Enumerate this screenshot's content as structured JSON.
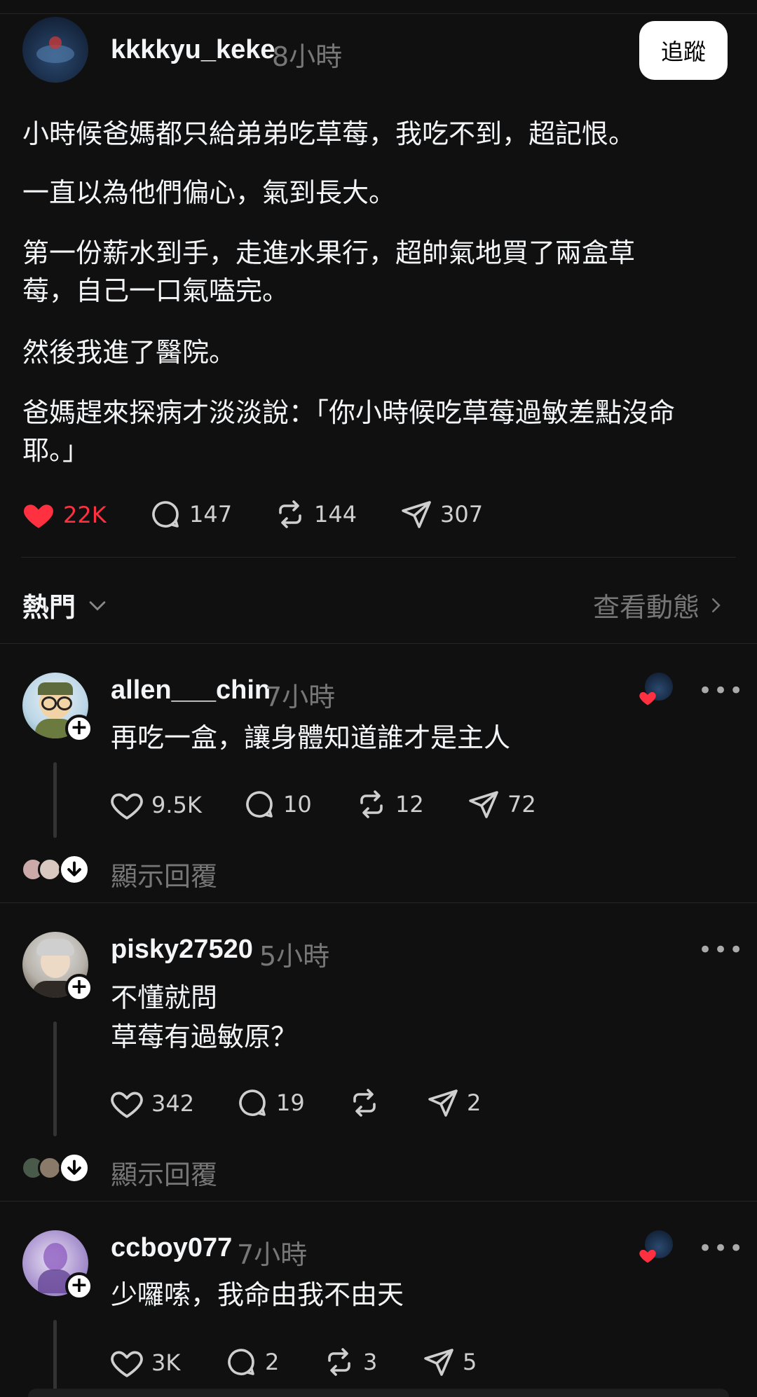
{
  "post": {
    "username": "kkkkyu_keke",
    "time": "8小時",
    "follow_label": "追蹤",
    "paragraphs": [
      "小時候爸媽都只給弟弟吃草莓，我吃不到，超記恨。",
      "一直以為他們偏心，氣到長大。",
      "第一份薪水到手，走進水果行，超帥氣地買了兩盒草\n莓，自己一口氣嗑完。",
      "然後我進了醫院。",
      "爸媽趕來探病才淡淡說：「你小時候吃草莓過敏差點沒命\n耶。」"
    ],
    "likes": "22K",
    "comments": "147",
    "reposts": "144",
    "shares": "307"
  },
  "sort": {
    "label": "熱門",
    "activity_label": "查看動態"
  },
  "replies": [
    {
      "username": "allen___chin",
      "time": "7小時",
      "text": "再吃一盒，讓身體知道誰才是主人",
      "likes": "9.5K",
      "comments": "10",
      "reposts": "12",
      "shares": "72",
      "show_replies": "顯示回覆",
      "more": "•••"
    },
    {
      "username": "pisky27520",
      "time": "5小時",
      "text": "不懂就問\n草莓有過敏原？",
      "likes": "342",
      "comments": "19",
      "reposts": "",
      "shares": "2",
      "show_replies": "顯示回覆",
      "more": "•••"
    },
    {
      "username": "ccboy077",
      "time": "7小時",
      "text": "少囉嗦，我命由我不由天",
      "likes": "3K",
      "comments": "2",
      "reposts": "3",
      "shares": "5",
      "more": "•••"
    }
  ],
  "colors": {
    "background": "#101010",
    "like_active": "#ff3040",
    "text_muted": "#777777"
  }
}
